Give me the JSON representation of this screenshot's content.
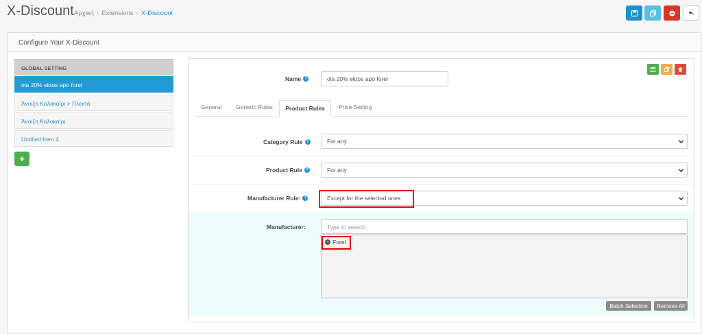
{
  "header": {
    "title": "X-Discount",
    "breadcrumb": [
      "Αρχική",
      "Extensions",
      "X-Discount"
    ],
    "colors": {
      "save": "#1e91cf",
      "copy": "#5bc0de",
      "delete": "#d9362b"
    }
  },
  "panel": {
    "title": "Configure Your X-Discount"
  },
  "sidebar": {
    "header": "GLOBAL SETTING",
    "items": [
      {
        "label": "ola 20% ektos apo forel",
        "active": true
      },
      {
        "label": "Άνοιξη Καλοκαίρι > Πλεκτά",
        "active": false
      },
      {
        "label": "Άνοιξη Καλοκαίρι",
        "active": false
      },
      {
        "label": "Untitled Item 4",
        "active": false
      }
    ],
    "add_icon": "+"
  },
  "form": {
    "name_label": "Name",
    "name_value": "ola 20% ektos apo forel",
    "tabs": [
      {
        "label": "General",
        "active": false
      },
      {
        "label": "Generic Rules",
        "active": false
      },
      {
        "label": "Product Rules",
        "active": true
      },
      {
        "label": "Price Setting",
        "active": false
      }
    ],
    "category_rule_label": "Category Rule",
    "category_rule_value": "For any",
    "product_rule_label": "Product Rule",
    "product_rule_value": "For any",
    "manufacturer_rule_label": "Manufacturer Rule:",
    "manufacturer_rule_value": "Except for the selected ones",
    "manufacturer_label": "Manufacturer:",
    "manufacturer_placeholder": "Type to search",
    "selected_manufacturers": [
      "Forel"
    ],
    "batch_selection_label": "Batch Selection",
    "remove_all_label": "Remove All"
  }
}
